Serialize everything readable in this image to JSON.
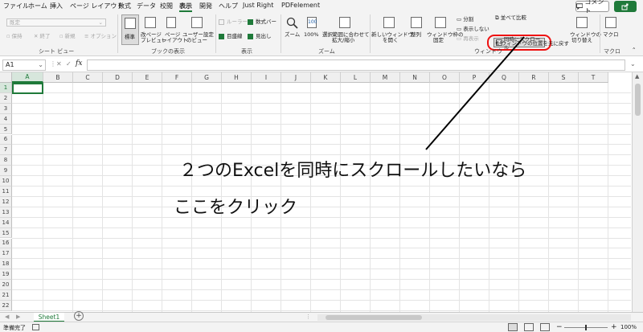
{
  "menu": {
    "tabs": [
      "ファイル",
      "ホーム",
      "挿入",
      "ページ レイアウト",
      "数式",
      "データ",
      "校閲",
      "表示",
      "開発",
      "ヘルプ",
      "Just Right",
      "PDFelement"
    ],
    "active_tab": "表示",
    "comment_label": "コメント"
  },
  "ribbon": {
    "sheet_view": {
      "default_select": "既定",
      "keep": "保持",
      "exit": "終了",
      "new": "新規",
      "options": "オプション",
      "group_label": "シート ビュー"
    },
    "book_view": {
      "normal": "標準",
      "page_break_1": "改ページ",
      "page_break_2": "プレビュー",
      "page_layout_1": "ページ",
      "page_layout_2": "レイアウト",
      "custom_1": "ユーザー設定",
      "custom_2": "のビュー",
      "group_label": "ブックの表示"
    },
    "show": {
      "ruler": "ルーラー",
      "formula_bar": "数式バー",
      "gridlines": "目盛線",
      "headings": "見出し",
      "group_label": "表示"
    },
    "zoom": {
      "zoom": "ズーム",
      "hundred": "100%",
      "fit_1": "選択範囲に合わせて",
      "fit_2": "拡大/縮小",
      "group_label": "ズーム"
    },
    "window": {
      "new_window_1": "新しいウィンドウ",
      "new_window_2": "を開く",
      "arrange": "整列",
      "freeze_1": "ウィンドウ枠の",
      "freeze_2": "固定",
      "split": "分割",
      "hide": "表示しない",
      "unhide": "再表示",
      "side_by_side": "並べて比較",
      "sync_scroll": "同時にスクロール",
      "reset_position": "ウィンドウの位置を元に戻す",
      "switch_1": "ウィンドウの",
      "switch_2": "切り替え",
      "group_label": "ウィンドウ"
    },
    "macro": {
      "macro": "マクロ",
      "group_label": "マクロ"
    }
  },
  "formula_bar": {
    "name_box": "A1",
    "fx": "fx",
    "value": ""
  },
  "grid": {
    "columns": [
      "A",
      "B",
      "C",
      "D",
      "E",
      "F",
      "G",
      "H",
      "I",
      "J",
      "K",
      "L",
      "M",
      "N",
      "O",
      "P",
      "Q",
      "R",
      "S",
      "T"
    ],
    "rows": [
      "1",
      "2",
      "3",
      "4",
      "5",
      "6",
      "7",
      "8",
      "9",
      "10",
      "11",
      "12",
      "13",
      "14",
      "15",
      "16",
      "17",
      "18",
      "19",
      "20",
      "21",
      "22"
    ]
  },
  "annotation": {
    "line1": "２つのExcelを同時にスクロールしたいなら",
    "line2": "ここをクリック",
    "highlight_color": "#e11111"
  },
  "sheets": {
    "tabs": [
      "Sheet1"
    ],
    "add_icon": "plus-icon"
  },
  "status": {
    "ready": "準備完了",
    "zoom": "100%"
  },
  "colors": {
    "accent": "#1f7a3a"
  }
}
